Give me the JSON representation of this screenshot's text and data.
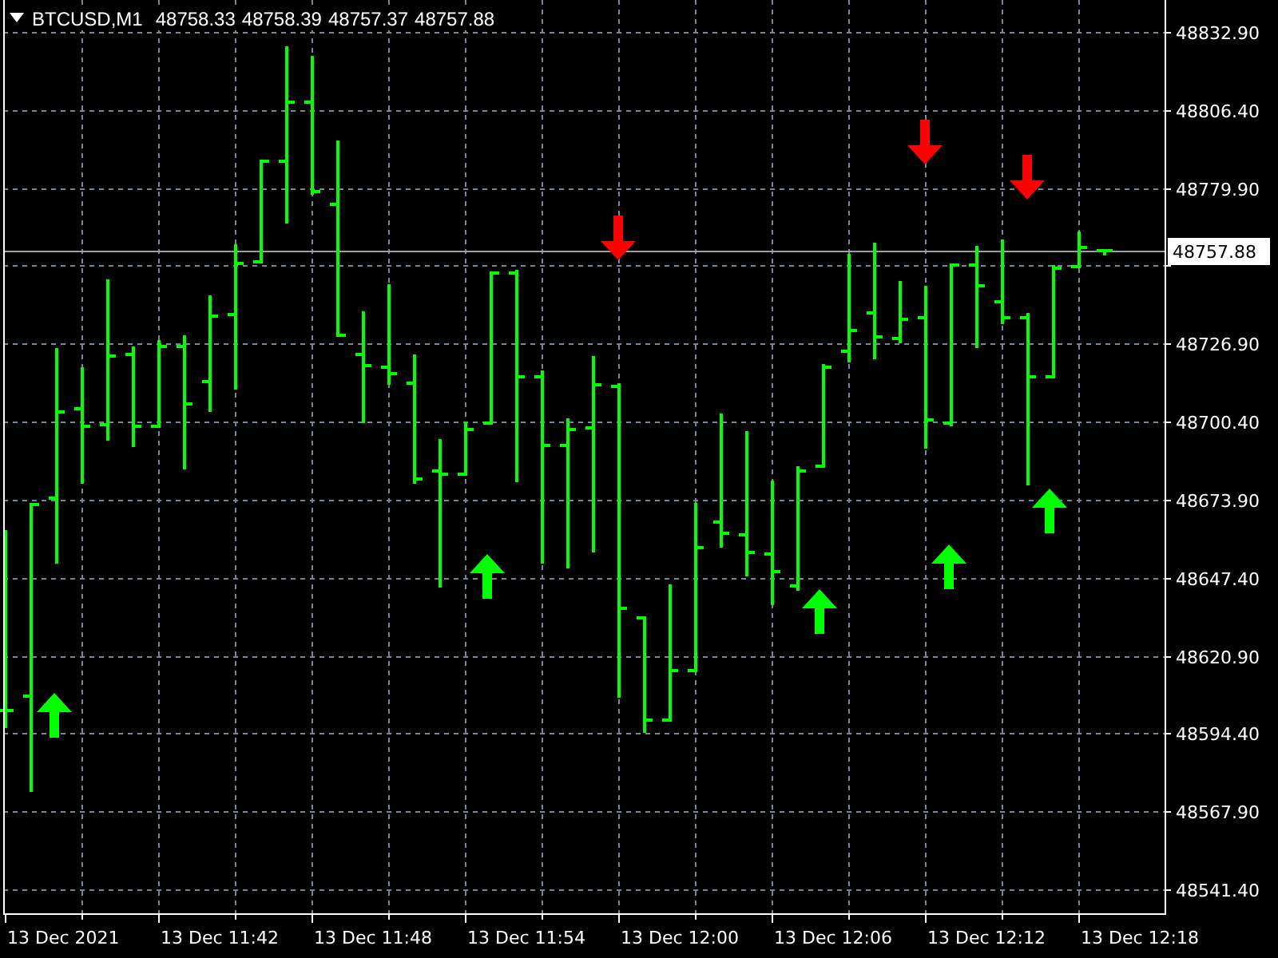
{
  "chart_header": {
    "symbol": "BTCUSD,M1",
    "quotes": [
      "48758.33",
      "48758.39",
      "48757.37",
      "48757.88"
    ]
  },
  "price_axis": {
    "ticks": [
      {
        "kind": "label",
        "label": "48832.90"
      },
      {
        "kind": "label",
        "label": "48806.40"
      },
      {
        "kind": "label",
        "label": "48779.90"
      },
      {
        "kind": "mark"
      },
      {
        "kind": "label",
        "label": "48726.90"
      },
      {
        "kind": "label",
        "label": "48700.40"
      },
      {
        "kind": "label",
        "label": "48673.90"
      },
      {
        "kind": "label",
        "label": "48647.40"
      },
      {
        "kind": "label",
        "label": "48620.90"
      },
      {
        "kind": "label",
        "label": "48594.40"
      },
      {
        "kind": "label",
        "label": "48567.90"
      },
      {
        "kind": "label",
        "label": "48541.40"
      }
    ],
    "current_price": "48757.88"
  },
  "time_axis": {
    "labels": [
      "13 Dec 2021",
      "13 Dec 11:42",
      "13 Dec 11:48",
      "13 Dec 11:54",
      "13 Dec 12:00",
      "13 Dec 12:06",
      "13 Dec 12:12",
      "13 Dec 12:18"
    ]
  }
}
